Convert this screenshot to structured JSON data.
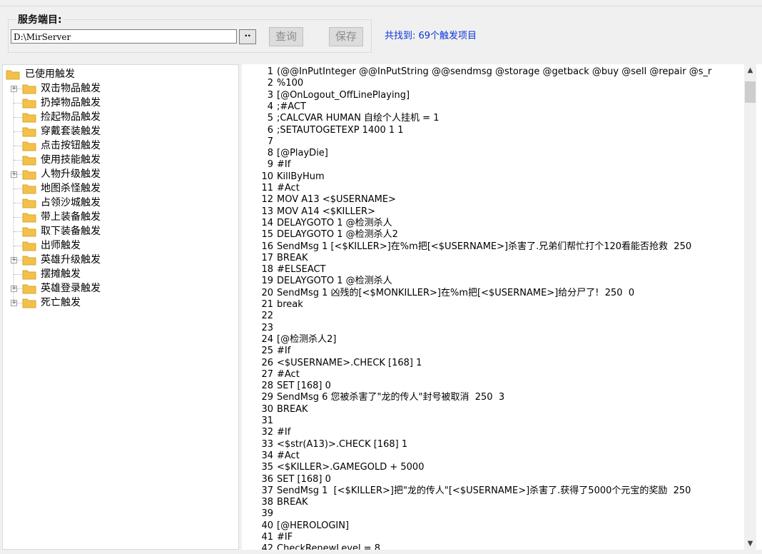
{
  "toolbar": {
    "group_label": "服务端目:",
    "path_value": "D:\\MirServer",
    "browse_label": "··",
    "query_label": "查询",
    "save_label": "保存",
    "status_text": "共找到: 69个触发项目"
  },
  "tree": {
    "root": {
      "label": "已使用触发"
    },
    "items": [
      {
        "label": "双击物品触发",
        "expandable": true
      },
      {
        "label": "扔掉物品触发",
        "expandable": false
      },
      {
        "label": "捡起物品触发",
        "expandable": false
      },
      {
        "label": "穿戴套装触发",
        "expandable": false
      },
      {
        "label": "点击按钮触发",
        "expandable": false
      },
      {
        "label": "使用技能触发",
        "expandable": false
      },
      {
        "label": "人物升级触发",
        "expandable": true
      },
      {
        "label": "地图杀怪触发",
        "expandable": false
      },
      {
        "label": "占领沙城触发",
        "expandable": false
      },
      {
        "label": "带上装备触发",
        "expandable": false
      },
      {
        "label": "取下装备触发",
        "expandable": false
      },
      {
        "label": "出师触发",
        "expandable": false
      },
      {
        "label": "英雄升级触发",
        "expandable": true
      },
      {
        "label": "摆摊触发",
        "expandable": false
      },
      {
        "label": "英雄登录触发",
        "expandable": true
      },
      {
        "label": "死亡触发",
        "expandable": true
      }
    ]
  },
  "editor": {
    "lines": [
      "(@@InPutInteger @@InPutString @@sendmsg @storage @getback @buy @sell @repair @s_r",
      "%100",
      "[@OnLogout_OffLinePlaying]",
      ";#ACT",
      ";CALCVAR HUMAN 自绘个人挂机 = 1",
      ";SETAUTOGETEXP 1400 1 1",
      "",
      "[@PlayDie]",
      "#If",
      "KillByHum",
      "#Act",
      "MOV A13 <$USERNAME>",
      "MOV A14 <$KILLER>",
      "DELAYGOTO 1 @检测杀人",
      "DELAYGOTO 1 @检测杀人2",
      "SendMsg 1 [<$KILLER>]在%m把[<$USERNAME>]杀害了.兄弟们帮忙打个120看能否抢救  250",
      "BREAK",
      "#ELSEACT",
      "DELAYGOTO 1 @检测杀人",
      "SendMsg 1 凶残的[<$MONKILLER>]在%m把[<$USERNAME>]给分尸了!  250  0",
      "break",
      "",
      "",
      "[@检测杀人2]",
      "#If",
      "<$USERNAME>.CHECK [168] 1",
      "#Act",
      "SET [168] 0",
      "SendMsg 6 您被杀害了\"龙的传人\"封号被取消  250  3",
      "BREAK",
      "",
      "#If",
      "<$str(A13)>.CHECK [168] 1",
      "#Act",
      "<$KILLER>.GAMEGOLD + 5000",
      "SET [168] 0",
      "SendMsg 1  [<$KILLER>]把\"龙的传人\"[<$USERNAME>]杀害了.获得了5000个元宝的奖励  250",
      "BREAK",
      "",
      "[@HEROLOGIN]",
      "#IF",
      "CheckRenewLevel = 8"
    ]
  },
  "scrollbar": {
    "up_icon": "chevron-up-icon",
    "down_icon": "chevron-down-icon",
    "position": 0.0
  },
  "colors": {
    "status": "#0a36d6",
    "folder": "#f3c14a"
  }
}
